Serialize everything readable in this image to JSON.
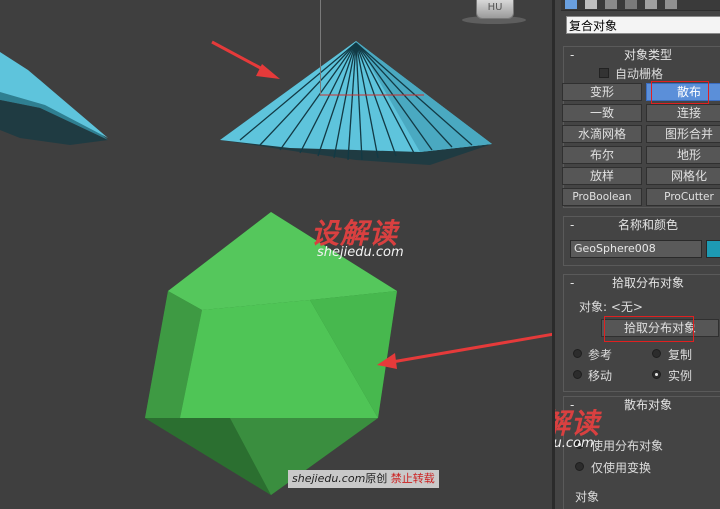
{
  "viewport": {
    "viewcube_label": "HU",
    "watermark_logo": "设解读",
    "watermark_url": "shejiedu.com",
    "copyright_site": "shejiedu.com",
    "copyright_original": "原创",
    "copyright_warning": "禁止转载",
    "colors": {
      "background": "#3f3f3f",
      "umbrella_blue": "#5ec4dc",
      "sphere_green": "#4cc455",
      "arrow_red": "#e53a3a",
      "watermark_red": "#d94040"
    }
  },
  "panel": {
    "dropdown_value": "复合对象",
    "object_type": {
      "header": "对象类型",
      "autogrid_label": "自动栅格",
      "autogrid_checked": false,
      "buttons": [
        {
          "label": "变形",
          "active": false
        },
        {
          "label": "散布",
          "active": true
        },
        {
          "label": "一致",
          "active": false
        },
        {
          "label": "连接",
          "active": false
        },
        {
          "label": "水滴网格",
          "active": false
        },
        {
          "label": "图形合并",
          "active": false
        },
        {
          "label": "布尔",
          "active": false
        },
        {
          "label": "地形",
          "active": false
        },
        {
          "label": "放样",
          "active": false
        },
        {
          "label": "网格化",
          "active": false
        },
        {
          "label": "ProBoolean",
          "active": false
        },
        {
          "label": "ProCutter",
          "active": false
        }
      ]
    },
    "name_color": {
      "header": "名称和颜色",
      "name_value": "GeoSphere008",
      "color": "#1d9ab3"
    },
    "pick_distribution": {
      "header": "拾取分布对象",
      "object_label": "对象: <无>",
      "pick_button": "拾取分布对象",
      "options": [
        {
          "label": "参考",
          "selected": false
        },
        {
          "label": "复制",
          "selected": false
        },
        {
          "label": "移动",
          "selected": false
        },
        {
          "label": "实例",
          "selected": true
        }
      ]
    },
    "scatter_objects": {
      "header": "散布对象",
      "option1": "使用分布对象",
      "option2": "仅使用变换",
      "objects_label": "对象"
    },
    "watermark_logo": "设解读",
    "watermark_url": "shejiedu.com"
  }
}
